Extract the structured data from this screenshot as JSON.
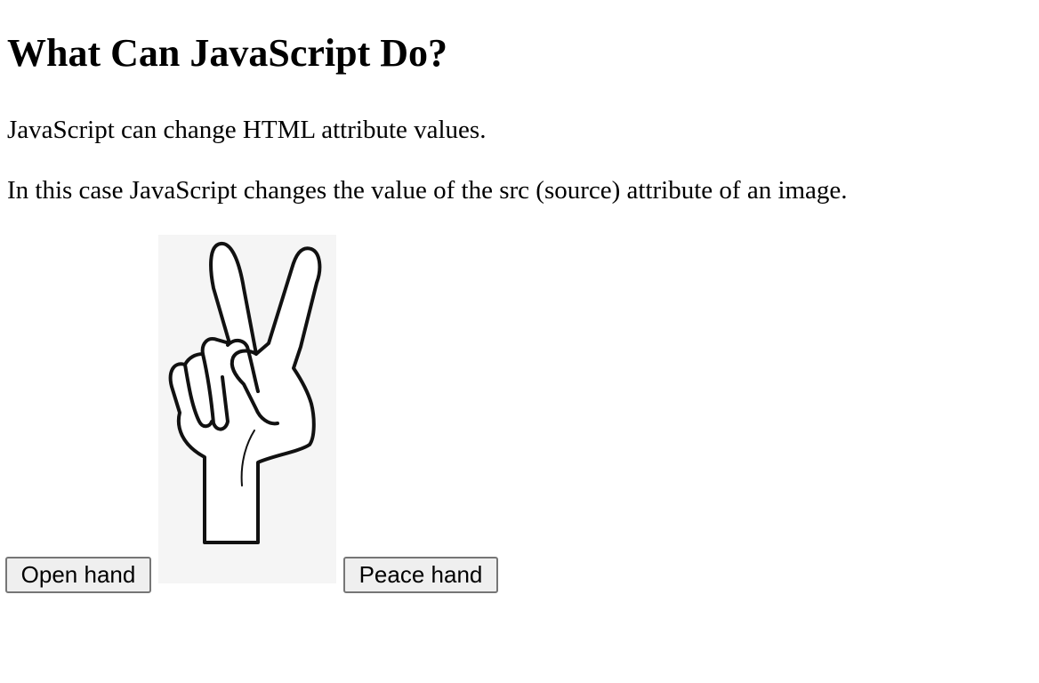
{
  "heading": "What Can JavaScript Do?",
  "paragraphs": {
    "p1": "JavaScript can change HTML attribute values.",
    "p2": "In this case JavaScript changes the value of the src (source) attribute of an image."
  },
  "buttons": {
    "open_hand": "Open hand",
    "peace_hand": "Peace hand"
  },
  "image": {
    "state": "peace-hand",
    "icon": "peace-hand-icon"
  }
}
